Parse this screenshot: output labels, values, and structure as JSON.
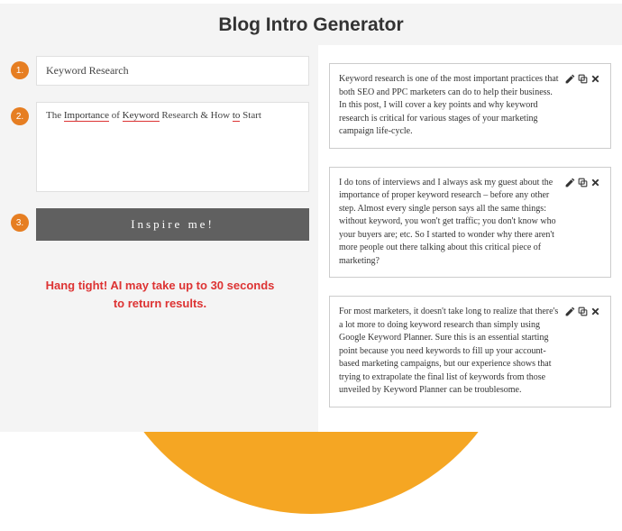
{
  "title": "Blog Intro Generator",
  "steps": {
    "one": "1.",
    "two": "2.",
    "three": "3."
  },
  "keyword_input": {
    "value": "Keyword Research"
  },
  "title_input": {
    "prefix": "The ",
    "w1": "Importance",
    "mid1": " of ",
    "w2": "Keyword",
    "mid2": " Research & How ",
    "w3": "to",
    "suffix": " Start"
  },
  "button_label": "Inspire me!",
  "wait_line1": "Hang tight! AI may take up to 30 seconds",
  "wait_line2": "to return results.",
  "results": [
    {
      "text": "Keyword research is one of the most important practices that both SEO and PPC marketers can do to help their business. In this post, I will cover a key points and why keyword research is critical for various stages of your marketing campaign life-cycle."
    },
    {
      "text": "I do tons of interviews and I always ask my guest about the importance of proper keyword research – before any other step. Almost every single person says all the same things: without keyword, you won't get traffic; you don't know who your buyers are; etc. So I started to wonder why there aren't more people out there talking about this critical piece of marketing?"
    },
    {
      "text": "For most marketers, it doesn't take long to realize that there's a lot more to doing keyword research than simply using Google Keyword Planner. Sure this is an essential starting point because you need keywords to fill up your account-based marketing campaigns, but our experience shows that trying to extrapolate the final list of keywords from those unveiled by Keyword Planner can be troublesome."
    }
  ]
}
